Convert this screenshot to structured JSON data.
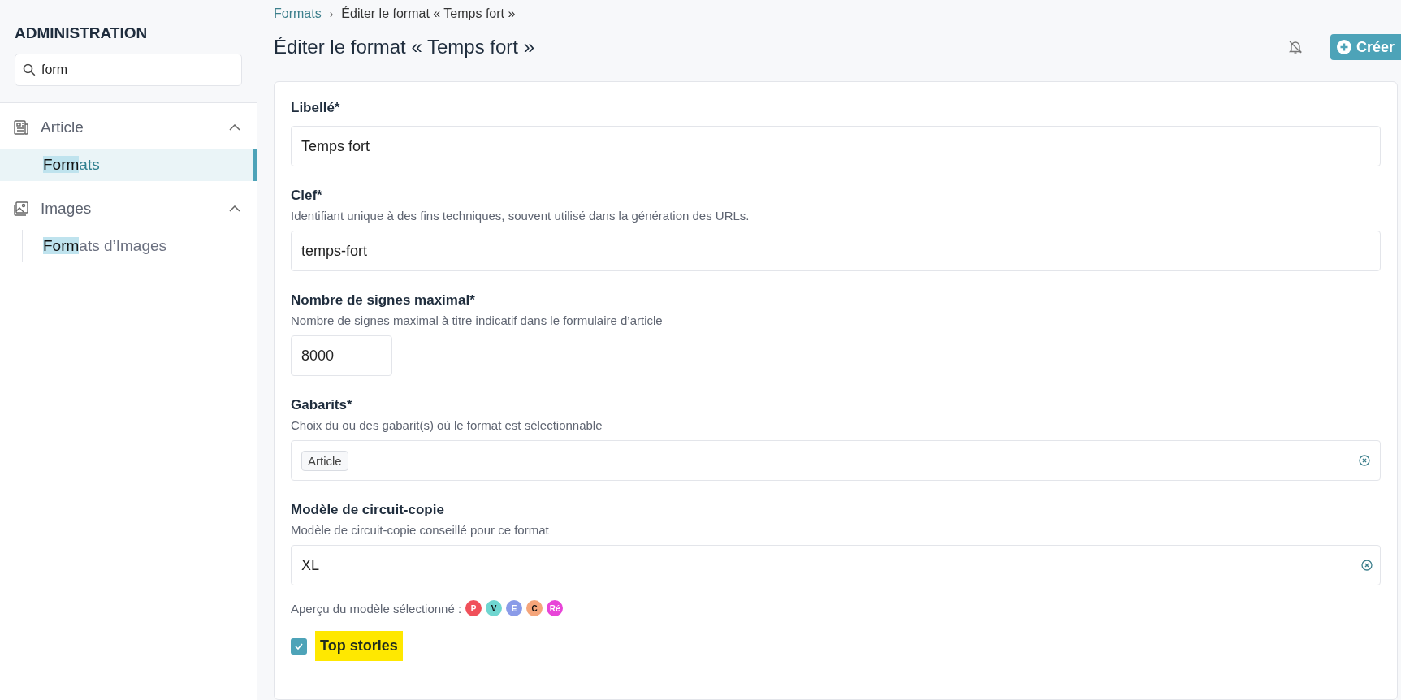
{
  "sidebar": {
    "title": "ADMINISTRATION",
    "search": {
      "value": "form"
    },
    "sections": [
      {
        "kind": "article",
        "label": "Article",
        "expanded": true,
        "children": [
          {
            "match": "Form",
            "rest": "ats",
            "selected": true
          }
        ]
      },
      {
        "kind": "images",
        "label": "Images",
        "expanded": true,
        "children": [
          {
            "match": "Form",
            "rest": "ats d’Images",
            "selected": false
          }
        ]
      }
    ]
  },
  "breadcrumb": [
    {
      "label": "Formats",
      "kind": "link"
    },
    {
      "label": "›",
      "kind": "separator"
    },
    {
      "label": "Éditer le format « Temps fort »",
      "kind": "current"
    }
  ],
  "page_title": "Éditer le format « Temps fort »",
  "header_actions": {
    "notifications_muted": true,
    "create_button": "Créer"
  },
  "form": {
    "fields": [
      {
        "kind": "text",
        "label": "Libellé*",
        "value": "Temps fort"
      },
      {
        "kind": "text",
        "label": "Clef*",
        "description": "Identifiant unique à des fins techniques, souvent utilisé dans la génération des URLs.",
        "value": "temps-fort"
      },
      {
        "kind": "number",
        "label": "Nombre de signes maximal*",
        "description": "Nombre de signes maximal à titre indicatif dans le formulaire d’article",
        "value": "8000"
      },
      {
        "kind": "tags",
        "label": "Gabarits*",
        "description": "Choix du ou des gabarit(s) où le format est sélectionnable",
        "tags": [
          "Article"
        ]
      },
      {
        "kind": "select",
        "label": "Modèle de circuit-copie",
        "description": "Modèle de circuit-copie conseillé pour ce format",
        "value": "XL"
      }
    ],
    "preview": {
      "label": "Aperçu du modèle sélectionné :",
      "steps": [
        {
          "label": "P",
          "color": "#f0505a"
        },
        {
          "label": "V",
          "color": "#6fd6d0"
        },
        {
          "label": "E",
          "color": "#8a9be8"
        },
        {
          "label": "C",
          "color": "#f5a57a"
        },
        {
          "label": "Ré",
          "color": "#e845d8"
        }
      ]
    },
    "checkbox": {
      "label": "Top stories",
      "checked": true
    }
  }
}
